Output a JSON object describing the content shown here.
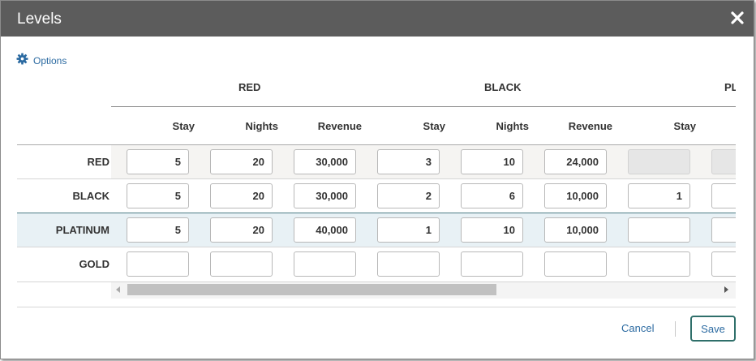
{
  "dialog": {
    "title": "Levels",
    "close_icon": "close-icon",
    "options_label": "Options",
    "options_icon": "gear-icon",
    "accent_color": "#2b6aa1"
  },
  "table": {
    "groups": [
      "RED",
      "BLACK",
      "PLAT"
    ],
    "sub_columns": [
      "Stay",
      "Nights",
      "Revenue",
      "Stay",
      "Nights",
      "Revenue",
      "Stay",
      ""
    ],
    "rows": [
      {
        "label": "RED",
        "values": [
          "5",
          "20",
          "30,000",
          "3",
          "10",
          "24,000",
          "",
          ""
        ],
        "disabled": [
          false,
          false,
          false,
          false,
          false,
          false,
          true,
          true
        ]
      },
      {
        "label": "BLACK",
        "values": [
          "5",
          "20",
          "30,000",
          "2",
          "6",
          "10,000",
          "1",
          ""
        ],
        "disabled": [
          false,
          false,
          false,
          false,
          false,
          false,
          false,
          false
        ]
      },
      {
        "label": "PLATINUM",
        "values": [
          "5",
          "20",
          "40,000",
          "1",
          "10",
          "10,000",
          "",
          ""
        ],
        "disabled": [
          false,
          false,
          false,
          false,
          false,
          false,
          false,
          false
        ],
        "selected": true
      },
      {
        "label": "GOLD",
        "values": [
          "",
          "",
          "",
          "",
          "",
          "",
          "",
          ""
        ],
        "disabled": [
          false,
          false,
          false,
          false,
          false,
          false,
          false,
          false
        ]
      }
    ]
  },
  "footer": {
    "cancel_label": "Cancel",
    "save_label": "Save"
  }
}
